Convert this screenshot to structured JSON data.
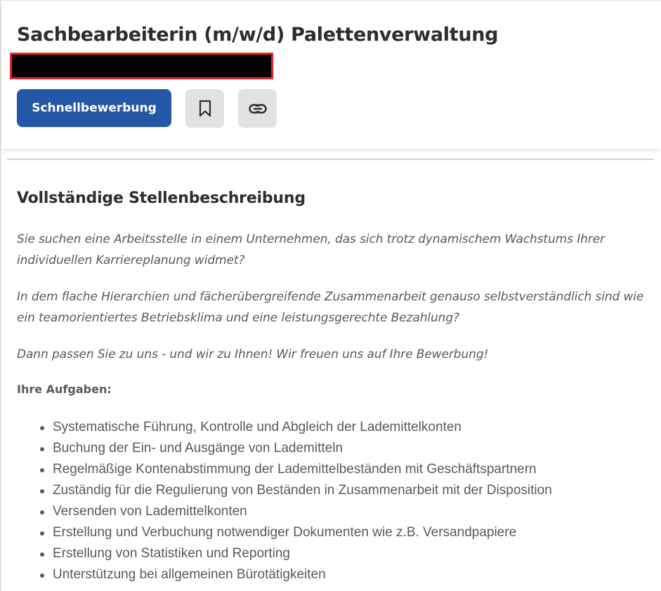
{
  "job": {
    "title": "Sachbearbeiterin (m/w/d) Palettenverwaltung",
    "apply_label": "Schnellbewerbung",
    "save_icon": "bookmark-icon",
    "copy_link_icon": "link-icon"
  },
  "description": {
    "heading": "Vollständige Stellenbeschreibung",
    "intro": [
      "Sie suchen eine Arbeitsstelle in einem Unternehmen, das sich trotz dynamischem Wachstums Ihrer individuellen Karriereplanung widmet?",
      "In dem flache Hierarchien und fächerübergreifende Zusammenarbeit genauso selbstverständlich sind wie ein teamorientiertes Betriebsklima und eine leistungsgerechte Bezahlung?",
      "Dann passen Sie zu uns - und wir zu Ihnen! Wir freuen uns auf Ihre Bewerbung!"
    ],
    "tasks_heading": "Ihre Aufgaben:",
    "tasks": [
      "Systematische Führung, Kontrolle und Abgleich der Lademittelkonten",
      "Buchung der Ein- und Ausgänge von Lademitteln",
      "Regelmäßige Kontenabstimmung der Lademittelbeständen mit Geschäftspartnern",
      "Zuständig für die Regulierung von Beständen in Zusammenarbeit mit der Disposition",
      "Versenden von Lademittelkonten",
      "Erstellung und Verbuchung notwendiger Dokumenten wie z.B. Versandpapiere",
      "Erstellung von Statistiken und Reporting",
      "Unterstützung bei allgemeinen Bürotätigkeiten"
    ]
  },
  "colors": {
    "primary": "#2557a7",
    "icon_button_bg": "#e4e2e0",
    "redaction_border": "#e8202a",
    "redaction_fill": "#000000"
  }
}
